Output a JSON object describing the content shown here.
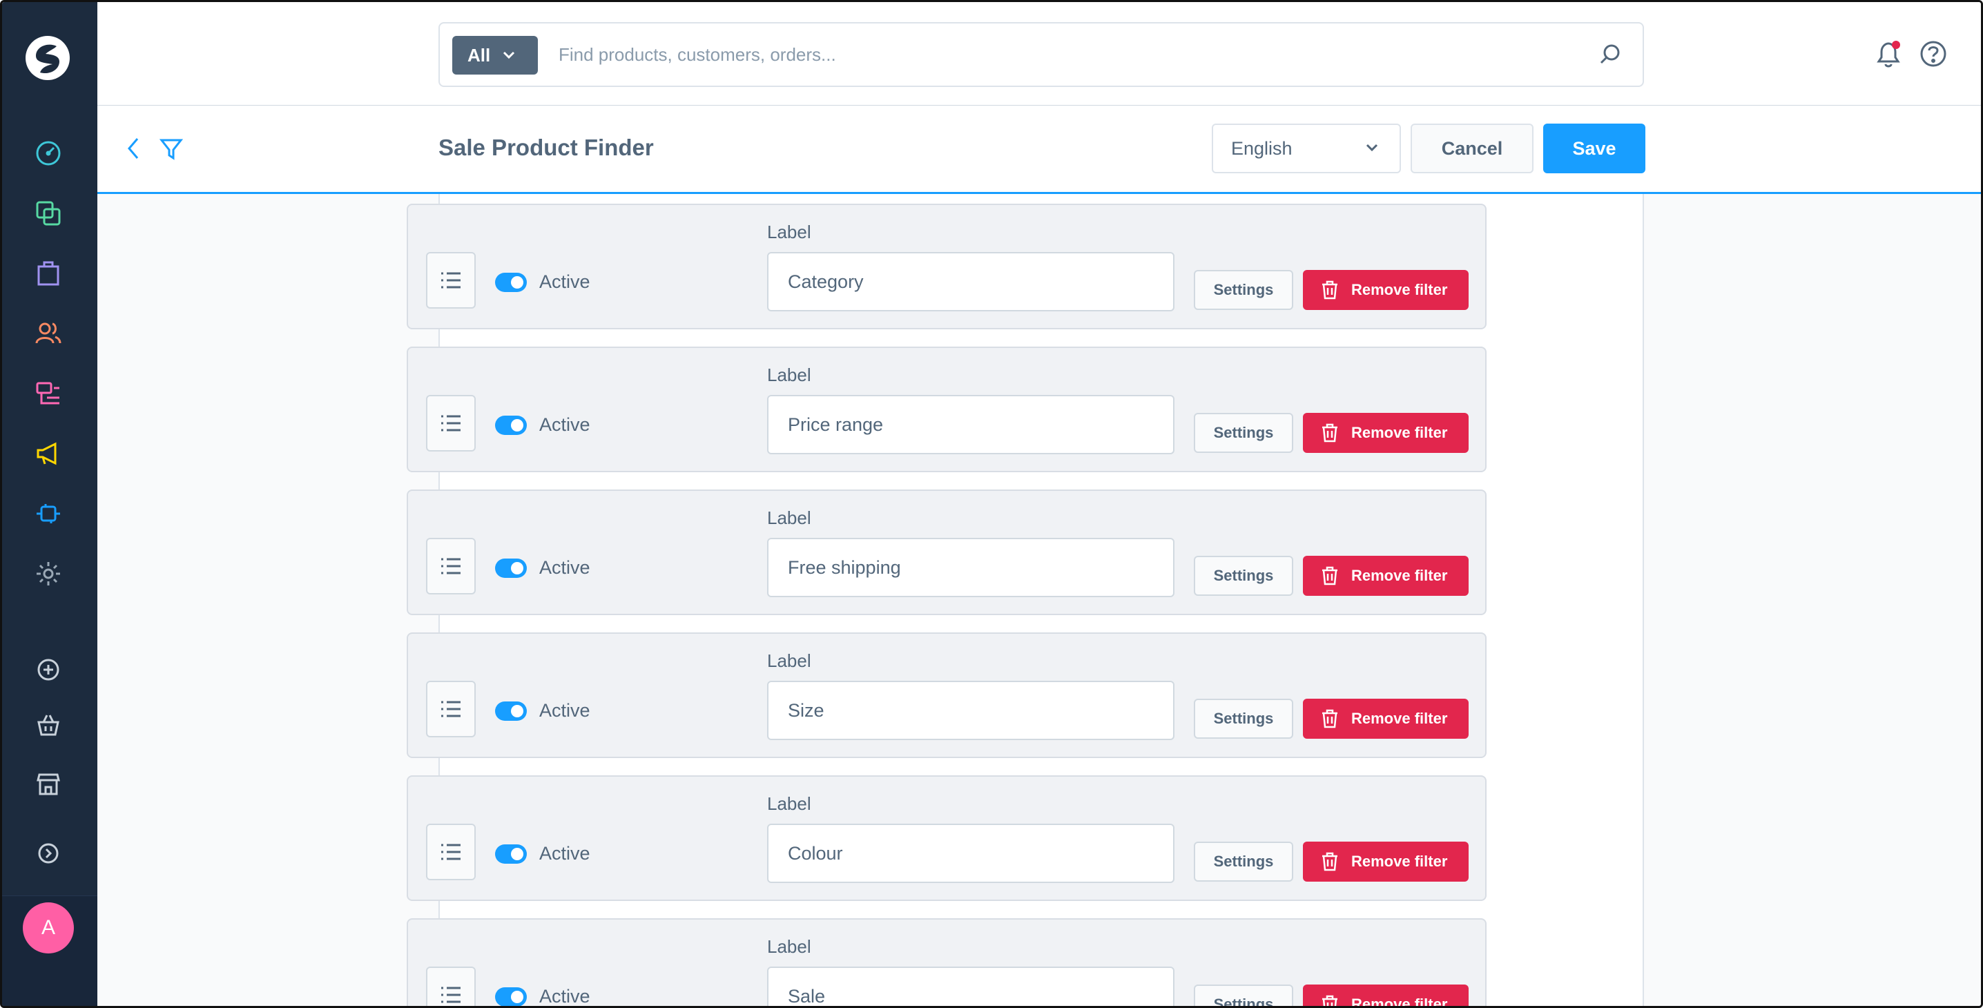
{
  "search": {
    "scope": "All",
    "placeholder": "Find products, customers, orders..."
  },
  "smartbar": {
    "title": "Sale Product Finder",
    "language": "English",
    "cancel_label": "Cancel",
    "save_label": "Save"
  },
  "user": {
    "initial": "A"
  },
  "colors": {
    "sidebar": "#1c2b3e",
    "primary": "#189eff",
    "danger": "#e2264d",
    "text": "#52667a"
  },
  "filters": [
    {
      "label_caption": "Label",
      "label": "Category",
      "status": "Active",
      "settings_label": "Settings",
      "remove_label": "Remove filter"
    },
    {
      "label_caption": "Label",
      "label": "Price range",
      "status": "Active",
      "settings_label": "Settings",
      "remove_label": "Remove filter"
    },
    {
      "label_caption": "Label",
      "label": "Free shipping",
      "status": "Active",
      "settings_label": "Settings",
      "remove_label": "Remove filter"
    },
    {
      "label_caption": "Label",
      "label": "Size",
      "status": "Active",
      "settings_label": "Settings",
      "remove_label": "Remove filter"
    },
    {
      "label_caption": "Label",
      "label": "Colour",
      "status": "Active",
      "settings_label": "Settings",
      "remove_label": "Remove filter"
    },
    {
      "label_caption": "Label",
      "label": "Sale",
      "status": "Active",
      "settings_label": "Settings",
      "remove_label": "Remove filter"
    }
  ]
}
